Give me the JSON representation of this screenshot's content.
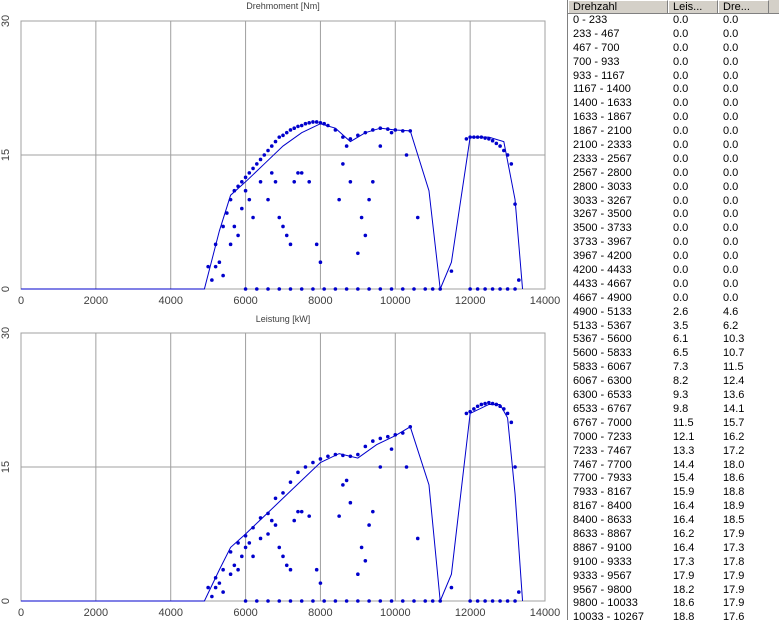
{
  "chart_data": [
    {
      "type": "scatter",
      "title": "Drehmoment [Nm]",
      "xlim": [
        0,
        14000
      ],
      "ylim": [
        0,
        30
      ],
      "x_ticks": [
        0,
        2000,
        4000,
        6000,
        8000,
        10000,
        12000,
        14000
      ],
      "y_ticks": [
        0,
        15,
        30
      ],
      "grid": true,
      "line": {
        "x": [
          0,
          4900,
          5300,
          5600,
          6000,
          6500,
          7000,
          7500,
          8000,
          8400,
          8800,
          9200,
          9600,
          10000,
          10400,
          10900,
          11200,
          11500,
          12000,
          12500,
          12900,
          13200,
          13400
        ],
        "y": [
          0,
          0,
          6.5,
          10.5,
          12,
          14,
          16,
          17.5,
          18.5,
          18,
          16.5,
          17.5,
          18,
          17.8,
          17.7,
          11,
          0,
          3,
          17,
          17,
          16.5,
          10,
          0
        ]
      },
      "points": {
        "envelope_x": [
          5000,
          5200,
          5400,
          5500,
          5600,
          5700,
          5800,
          5900,
          6000,
          6100,
          6200,
          6300,
          6400,
          6500,
          6600,
          6700,
          6800,
          6900,
          7000,
          7100,
          7200,
          7300,
          7400,
          7500,
          7600,
          7700,
          7800,
          7900,
          8000,
          8100,
          8200,
          8400,
          8600,
          8800,
          9000,
          9200,
          9400,
          9600,
          9800,
          10000,
          10200,
          10400,
          11900,
          12000,
          12100,
          12200,
          12300,
          12400,
          12500,
          12600,
          12700,
          12800,
          12900,
          13000,
          13100,
          13200,
          13300
        ],
        "envelope_y": [
          2.5,
          5,
          7,
          8.5,
          10,
          11,
          11.5,
          12,
          12.5,
          13,
          13.5,
          14,
          14.5,
          15,
          15.5,
          16,
          16.5,
          17,
          17.2,
          17.5,
          17.8,
          18,
          18.2,
          18.3,
          18.5,
          18.6,
          18.7,
          18.7,
          18.6,
          18.5,
          18.3,
          17.8,
          17,
          16.8,
          17.2,
          17.5,
          17.8,
          18,
          17.9,
          17.8,
          17.7,
          17.7,
          16.8,
          17,
          17,
          17,
          17,
          16.9,
          16.8,
          16.6,
          16.3,
          16,
          15.5,
          15,
          14,
          9.5,
          1
        ],
        "lower_x": [
          6000,
          6300,
          6600,
          6900,
          7200,
          7500,
          7800,
          8100,
          8400,
          8700,
          9000,
          9300,
          9600,
          9900,
          10200,
          10500,
          10800,
          11000,
          11200,
          12000,
          12200,
          12400,
          12600,
          12800,
          13000,
          13200
        ],
        "lower_y": [
          0,
          0,
          0,
          0,
          0,
          0,
          0,
          0,
          0,
          0,
          0,
          0,
          0,
          0,
          0,
          0,
          0,
          0,
          0,
          0,
          0,
          0,
          0,
          0,
          0,
          0
        ],
        "scatter_x": [
          5100,
          5200,
          5300,
          5400,
          5600,
          5700,
          5800,
          5900,
          6000,
          6100,
          6200,
          6400,
          6600,
          6700,
          6800,
          6900,
          7000,
          7100,
          7200,
          7300,
          7400,
          7500,
          7700,
          7900,
          8000,
          8500,
          8600,
          8700,
          8800,
          9000,
          9100,
          9200,
          9300,
          9400,
          9600,
          9900,
          10300,
          10600,
          11500
        ],
        "scatter_y": [
          1,
          2.5,
          3,
          1.5,
          5,
          7,
          6,
          9,
          11,
          10,
          8,
          12,
          10,
          13,
          12,
          8,
          7,
          6,
          5,
          12,
          13,
          13,
          12,
          5,
          3,
          10,
          14,
          16,
          12,
          4,
          8,
          6,
          10,
          12,
          16,
          17.5,
          15,
          8,
          2
        ]
      }
    },
    {
      "type": "scatter",
      "title": "Leistung [kW]",
      "xlim": [
        0,
        14000
      ],
      "ylim": [
        0,
        30
      ],
      "x_ticks": [
        0,
        2000,
        4000,
        6000,
        8000,
        10000,
        12000,
        14000
      ],
      "y_ticks": [
        0,
        15,
        30
      ],
      "grid": true,
      "line": {
        "x": [
          0,
          4900,
          5300,
          5600,
          6000,
          6500,
          7000,
          7500,
          8000,
          8500,
          9000,
          9500,
          10000,
          10400,
          10900,
          11200,
          11500,
          12000,
          12500,
          12800,
          13000,
          13200,
          13400
        ],
        "y": [
          0,
          0,
          3.5,
          6,
          7.5,
          9.5,
          11.5,
          13.5,
          15.5,
          16.5,
          16,
          17.5,
          18.5,
          19.5,
          13,
          0,
          3,
          21,
          22,
          22,
          20.5,
          12,
          0
        ]
      },
      "points": {
        "envelope_x": [
          5000,
          5200,
          5400,
          5600,
          5800,
          6000,
          6200,
          6400,
          6600,
          6800,
          7000,
          7200,
          7400,
          7600,
          7800,
          8000,
          8200,
          8400,
          8600,
          8800,
          9000,
          9200,
          9400,
          9600,
          9800,
          10000,
          10200,
          10400,
          11900,
          12000,
          12100,
          12200,
          12300,
          12400,
          12500,
          12600,
          12700,
          12800,
          12900,
          13000,
          13100,
          13200,
          13300
        ],
        "envelope_y": [
          1.5,
          2.6,
          3.5,
          5.5,
          6.5,
          7.3,
          8.2,
          9.3,
          9.8,
          11.5,
          12.1,
          13.3,
          14.4,
          15,
          15.5,
          15.9,
          16.2,
          16.4,
          16.3,
          16.2,
          16.4,
          17.3,
          17.9,
          18.2,
          18.4,
          18.6,
          18.8,
          19.5,
          21,
          21.2,
          21.5,
          21.8,
          22,
          22.1,
          22.2,
          22.1,
          22,
          21.8,
          21.5,
          21,
          20,
          15,
          1
        ],
        "lower_x": [
          6000,
          6300,
          6600,
          6900,
          7200,
          7500,
          7800,
          8100,
          8400,
          8700,
          9000,
          9300,
          9600,
          9900,
          10200,
          10500,
          10800,
          11000,
          11200,
          12000,
          12200,
          12400,
          12600,
          12800,
          13000,
          13200
        ],
        "lower_y": [
          0,
          0,
          0,
          0,
          0,
          0,
          0,
          0,
          0,
          0,
          0,
          0,
          0,
          0,
          0,
          0,
          0,
          0,
          0,
          0,
          0,
          0,
          0,
          0,
          0,
          0
        ],
        "scatter_x": [
          5100,
          5200,
          5300,
          5400,
          5600,
          5700,
          5800,
          5900,
          6000,
          6100,
          6200,
          6400,
          6600,
          6700,
          6800,
          6900,
          7000,
          7100,
          7200,
          7300,
          7400,
          7500,
          7700,
          7900,
          8000,
          8500,
          8600,
          8700,
          8800,
          9000,
          9100,
          9200,
          9300,
          9400,
          9600,
          9900,
          10300,
          10600,
          11500
        ],
        "scatter_y": [
          0.5,
          1.5,
          2,
          1,
          3,
          4,
          3.5,
          5,
          6,
          6.5,
          5,
          7,
          7.5,
          9,
          8.5,
          6,
          5,
          4,
          3.5,
          9,
          10,
          10,
          9.5,
          3.5,
          2,
          9.5,
          13,
          13.5,
          11,
          3,
          6,
          4.5,
          8.5,
          10,
          15,
          17,
          15,
          7,
          1.5
        ]
      }
    }
  ],
  "table": {
    "headers": [
      "Drehzahl",
      "Leis...",
      "Dre..."
    ],
    "rows": [
      [
        "0 - 233",
        "0.0",
        "0.0"
      ],
      [
        "233 - 467",
        "0.0",
        "0.0"
      ],
      [
        "467 - 700",
        "0.0",
        "0.0"
      ],
      [
        "700 - 933",
        "0.0",
        "0.0"
      ],
      [
        "933 - 1167",
        "0.0",
        "0.0"
      ],
      [
        "1167 - 1400",
        "0.0",
        "0.0"
      ],
      [
        "1400 - 1633",
        "0.0",
        "0.0"
      ],
      [
        "1633 - 1867",
        "0.0",
        "0.0"
      ],
      [
        "1867 - 2100",
        "0.0",
        "0.0"
      ],
      [
        "2100 - 2333",
        "0.0",
        "0.0"
      ],
      [
        "2333 - 2567",
        "0.0",
        "0.0"
      ],
      [
        "2567 - 2800",
        "0.0",
        "0.0"
      ],
      [
        "2800 - 3033",
        "0.0",
        "0.0"
      ],
      [
        "3033 - 3267",
        "0.0",
        "0.0"
      ],
      [
        "3267 - 3500",
        "0.0",
        "0.0"
      ],
      [
        "3500 - 3733",
        "0.0",
        "0.0"
      ],
      [
        "3733 - 3967",
        "0.0",
        "0.0"
      ],
      [
        "3967 - 4200",
        "0.0",
        "0.0"
      ],
      [
        "4200 - 4433",
        "0.0",
        "0.0"
      ],
      [
        "4433 - 4667",
        "0.0",
        "0.0"
      ],
      [
        "4667 - 4900",
        "0.0",
        "0.0"
      ],
      [
        "4900 - 5133",
        "2.6",
        "4.6"
      ],
      [
        "5133 - 5367",
        "3.5",
        "6.2"
      ],
      [
        "5367 - 5600",
        "6.1",
        "10.3"
      ],
      [
        "5600 - 5833",
        "6.5",
        "10.7"
      ],
      [
        "5833 - 6067",
        "7.3",
        "11.5"
      ],
      [
        "6067 - 6300",
        "8.2",
        "12.4"
      ],
      [
        "6300 - 6533",
        "9.3",
        "13.6"
      ],
      [
        "6533 - 6767",
        "9.8",
        "14.1"
      ],
      [
        "6767 - 7000",
        "11.5",
        "15.7"
      ],
      [
        "7000 - 7233",
        "12.1",
        "16.2"
      ],
      [
        "7233 - 7467",
        "13.3",
        "17.2"
      ],
      [
        "7467 - 7700",
        "14.4",
        "18.0"
      ],
      [
        "7700 - 7933",
        "15.4",
        "18.6"
      ],
      [
        "7933 - 8167",
        "15.9",
        "18.8"
      ],
      [
        "8167 - 8400",
        "16.4",
        "18.9"
      ],
      [
        "8400 - 8633",
        "16.4",
        "18.5"
      ],
      [
        "8633 - 8867",
        "16.2",
        "17.9"
      ],
      [
        "8867 - 9100",
        "16.4",
        "17.3"
      ],
      [
        "9100 - 9333",
        "17.3",
        "17.8"
      ],
      [
        "9333 - 9567",
        "17.9",
        "17.9"
      ],
      [
        "9567 - 9800",
        "18.2",
        "17.9"
      ],
      [
        "9800 - 10033",
        "18.6",
        "17.9"
      ],
      [
        "10033 - 10267",
        "18.8",
        "17.6"
      ]
    ]
  },
  "colors": {
    "series": "#0000cc",
    "grid": "#a0a0a0",
    "axis": "#000000"
  }
}
